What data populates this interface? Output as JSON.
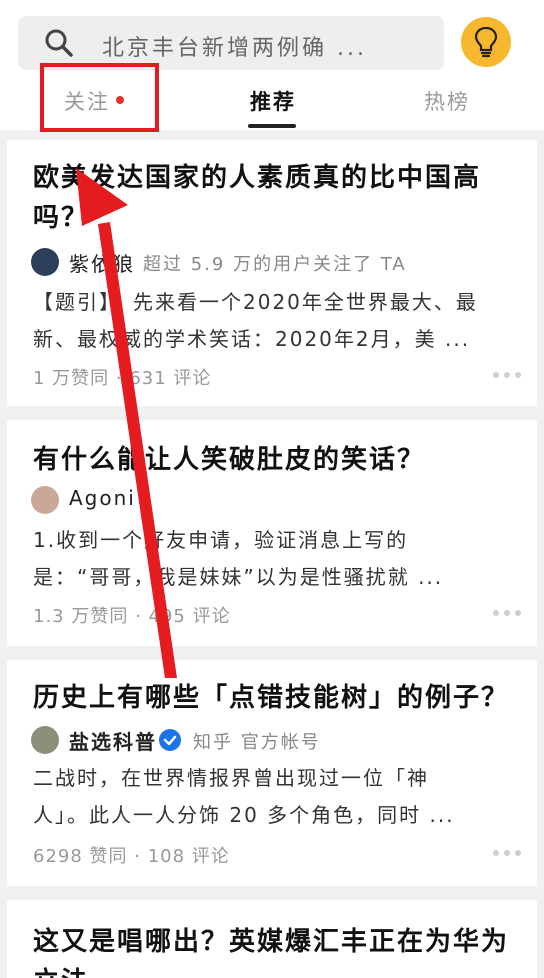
{
  "search": {
    "placeholder": "北京丰台新增两例确 ..."
  },
  "tabs": [
    {
      "label": "关注"
    },
    {
      "label": "推荐"
    },
    {
      "label": "热榜"
    }
  ],
  "feed": [
    {
      "title_line1": "欧美发达国家的人素质真的比中国高",
      "title_line2": "吗？",
      "author": "紫依狼",
      "author_desc": "超过 5.9 万的用户关注了 TA",
      "excerpt_line1": "【题引】：先来看一个2020年全世界最大、最",
      "excerpt_line2": "新、最权威的学术笑话：2020年2月，美 ...",
      "meta": "1 万赞同 · 631 评论"
    },
    {
      "title_line1": "有什么能让人笑破肚皮的笑话？",
      "author": "Agoni",
      "excerpt_line1": "1.收到一个好友申请，验证消息上写的",
      "excerpt_line2": "是：“哥哥，我是妹妹”以为是性骚扰就 ...",
      "meta": "1.3 万赞同 · 495 评论"
    },
    {
      "title_line1": "历史上有哪些「点错技能树」的例子？",
      "author": "盐选科普",
      "author_desc": "知乎 官方帐号",
      "excerpt_line1": "二战时，在世界情报界曾出现过一位「神",
      "excerpt_line2": "人」。此人一人分饰 20 多个角色，同时 ...",
      "meta": "6298 赞同 · 108 评论"
    },
    {
      "title_line1": "这又是唱哪出？英媒爆汇丰正在为华为",
      "title_line2": "立法"
    }
  ],
  "colors": {
    "accent_red": "#e41c20",
    "bulb_yellow": "#f7b82e",
    "verified_blue": "#1a73e8"
  },
  "icons": [
    "search-icon",
    "lightbulb-icon",
    "verified-icon",
    "more-icon",
    "arrow-annotation"
  ]
}
